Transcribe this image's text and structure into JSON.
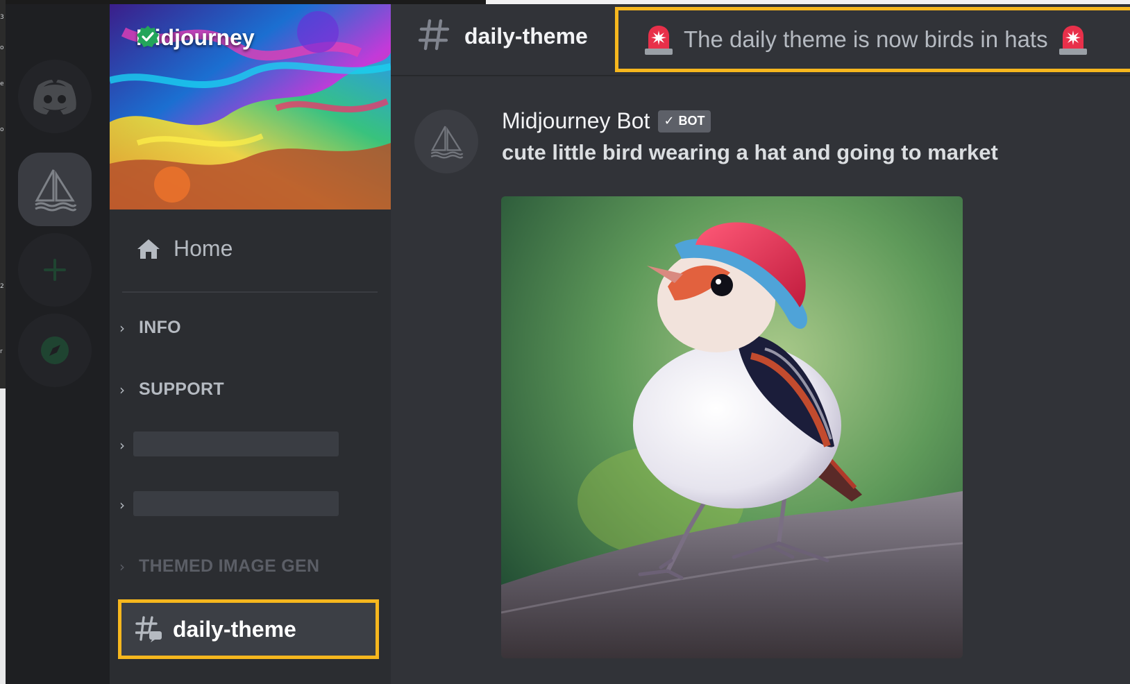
{
  "os_strip": {
    "tick_labels": [
      "3",
      "o",
      "e",
      "o",
      "2",
      "r"
    ]
  },
  "server": {
    "name": "Midjourney",
    "verified": true
  },
  "sidebar": {
    "home_label": "Home",
    "categories": [
      {
        "label": "INFO",
        "collapsed": true
      },
      {
        "label": "SUPPORT",
        "collapsed": true
      },
      {
        "label": "",
        "collapsed": true,
        "redacted": true
      },
      {
        "label": "",
        "collapsed": true,
        "redacted": true
      },
      {
        "label": "THEMED IMAGE GEN",
        "collapsed": true
      }
    ],
    "active_channel": {
      "label": "daily-theme",
      "icon": "hash-thread-icon",
      "highlight": "#f6b71e"
    }
  },
  "header": {
    "channel_name": "daily-theme",
    "topic": "The daily theme is now birds in hats",
    "topic_icon": "siren-icon"
  },
  "message": {
    "author": "Midjourney Bot",
    "tag": "BOT",
    "content": "cute little bird wearing a hat and going to market",
    "attachment": "image of a small bird wearing a red and blue hat standing on a branch"
  },
  "colors": {
    "highlight": "#f6b71e",
    "background": "#313338",
    "sidebar": "#2b2d31",
    "rail": "#1e1f22",
    "verified": "#23a55a"
  }
}
